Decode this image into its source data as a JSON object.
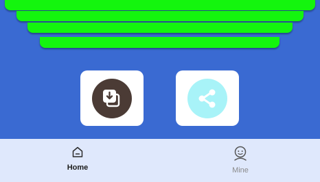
{
  "colors": {
    "background": "#3a6ad2",
    "bars": "#14f50e",
    "tile_bg": "#ffffff",
    "download_circle": "#4b3b35",
    "share_circle": "#a8f3f8",
    "tabbar_bg": "#dfe8fc"
  },
  "actions": {
    "download_icon": "download-icon",
    "share_icon": "share-icon"
  },
  "tabbar": {
    "tabs": [
      {
        "label": "Home",
        "icon": "home-icon",
        "active": true
      },
      {
        "label": "Mine",
        "icon": "user-face-icon",
        "active": false
      }
    ]
  }
}
